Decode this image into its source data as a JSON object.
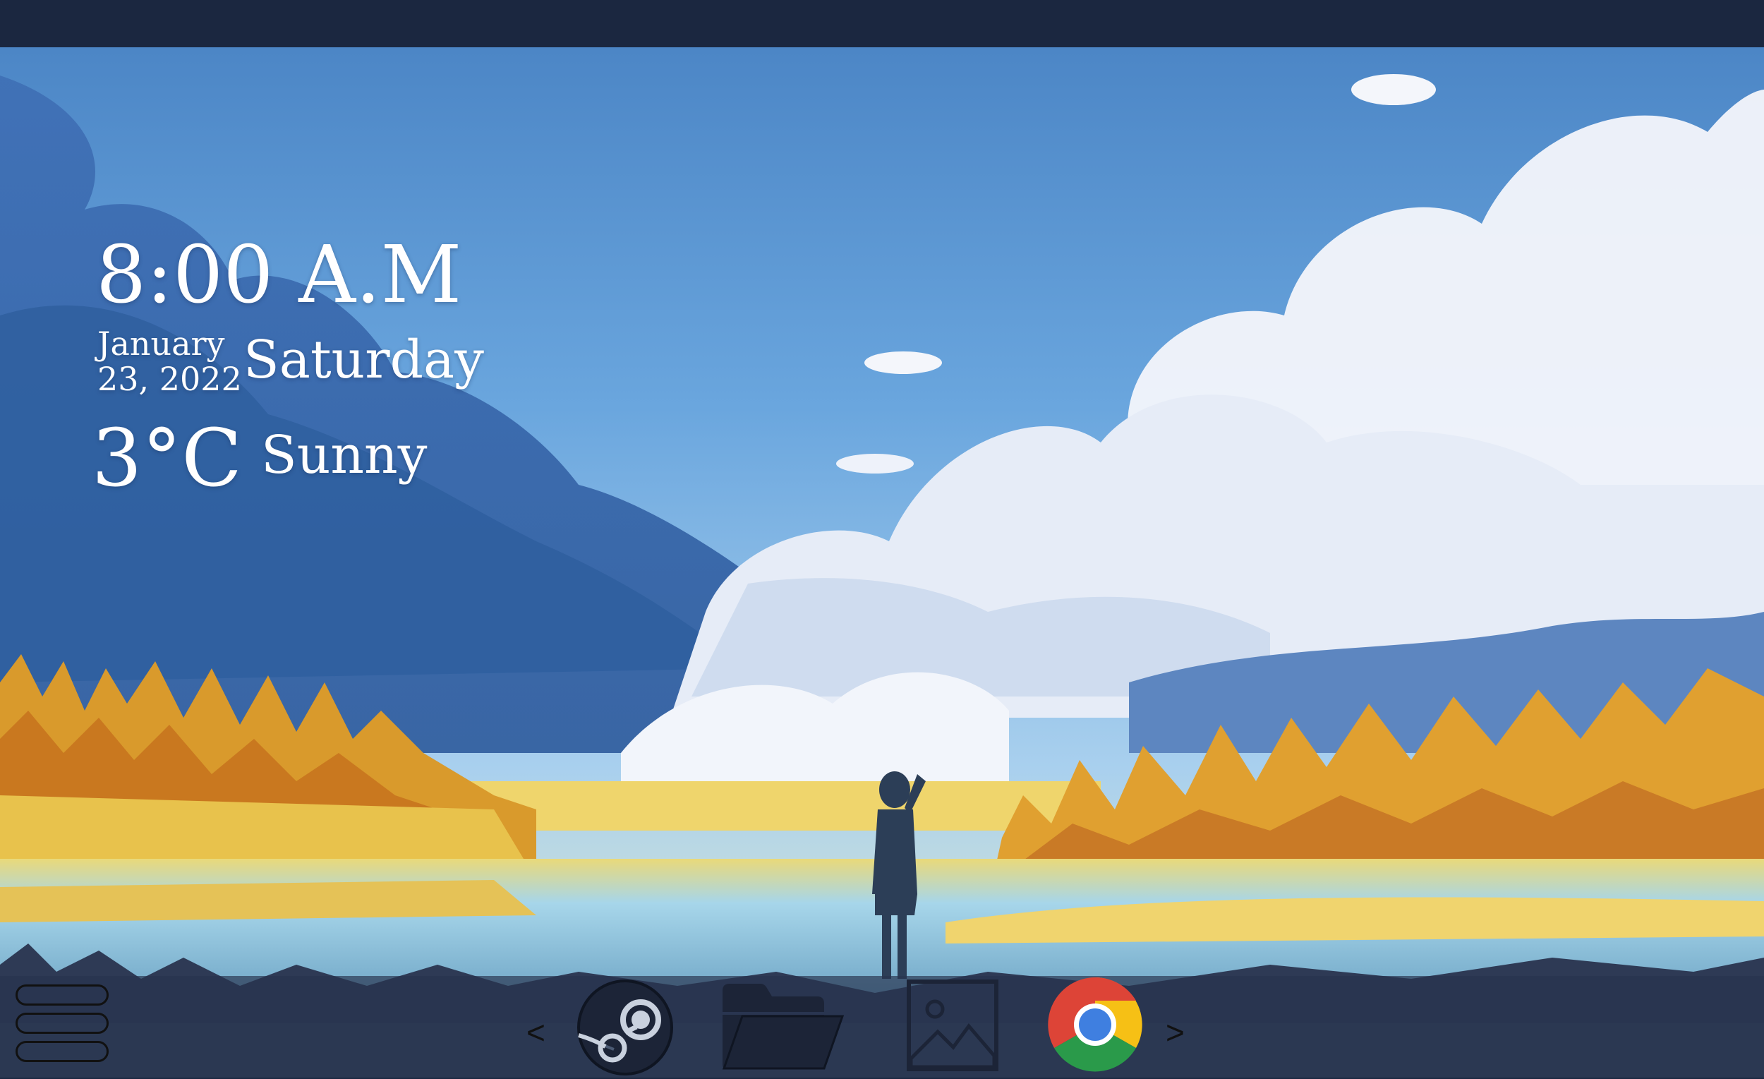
{
  "widget": {
    "time": "8:00 A.M",
    "date": "January\n23, 2022",
    "date_line1": "January",
    "date_line2": "23, 2022",
    "weekday": "Saturday",
    "temperature": "3°C",
    "condition": "Sunny"
  },
  "taskbar": {
    "prev_label": "<",
    "next_label": ">",
    "apps": [
      {
        "icon": "steam-icon"
      },
      {
        "icon": "folder-icon"
      },
      {
        "icon": "image-icon"
      },
      {
        "icon": "chrome-icon"
      }
    ]
  },
  "colors": {
    "topbar": "#1b2740",
    "sky": "#6aa6de",
    "widget_text": "#ffffff",
    "trees": "#e0a030",
    "water": "#9fd0e8"
  }
}
